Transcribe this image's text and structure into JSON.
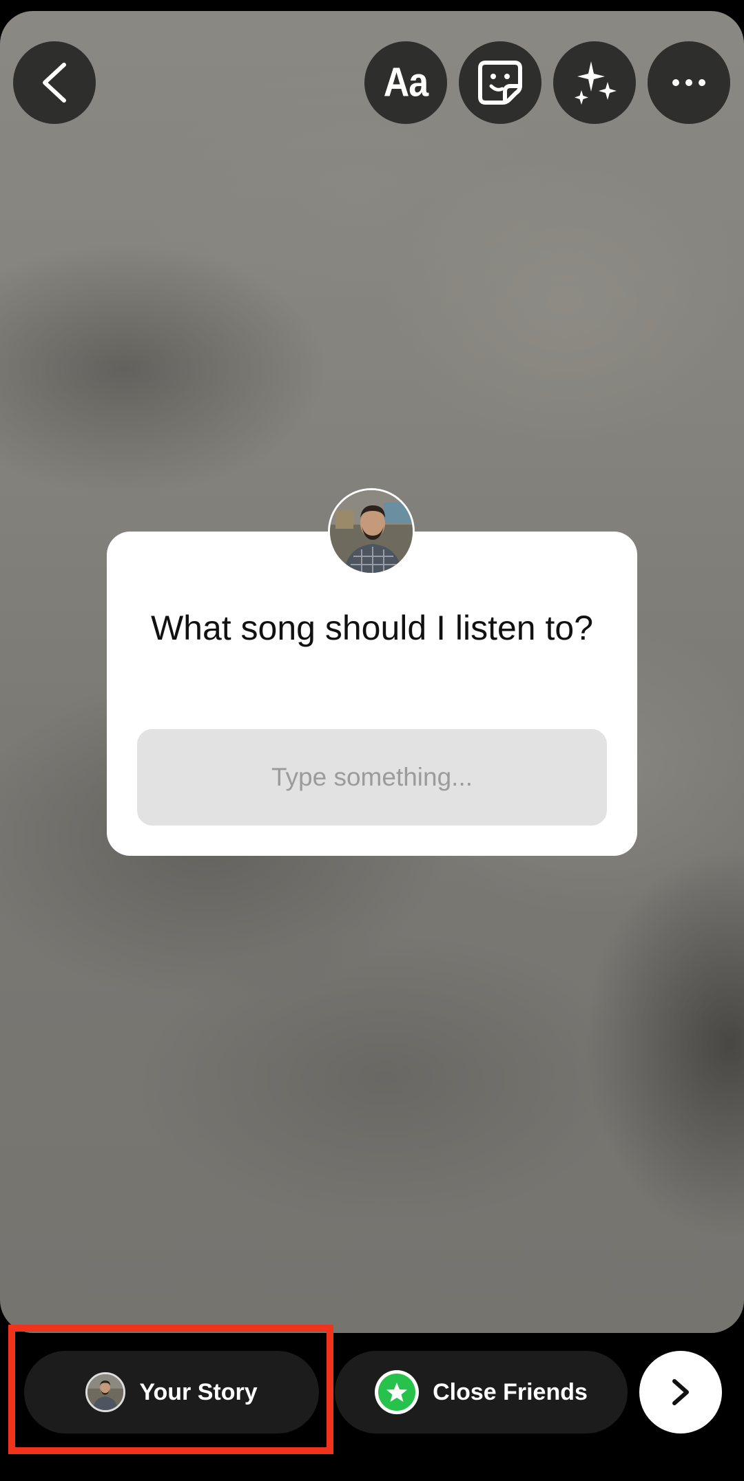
{
  "toolbar": {
    "back_icon": "chevron-left-icon",
    "text_tool_label": "Aa",
    "sticker_icon": "sticker-icon",
    "effects_icon": "sparkles-icon",
    "more_icon": "more-horizontal-icon"
  },
  "question_sticker": {
    "question": "What song should I listen to?",
    "input_placeholder": "Type something...",
    "avatar_icon": "profile-avatar"
  },
  "share_bar": {
    "your_story_label": "Your Story",
    "close_friends_label": "Close Friends",
    "close_friends_color": "#27c24c",
    "next_icon": "chevron-right-icon"
  },
  "annotation": {
    "highlight_color": "#f0341c"
  }
}
